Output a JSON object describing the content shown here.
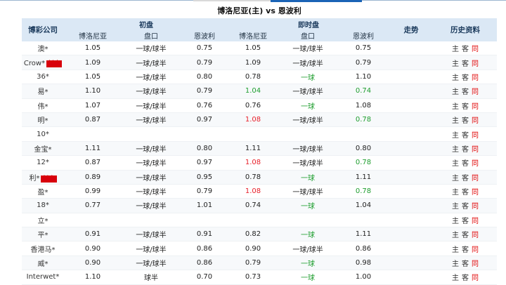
{
  "title": "博洛尼亚(主) vs 恩波利",
  "headers": {
    "company": "博彩公司",
    "initial": "初盘",
    "live": "即时盘",
    "trend": "走势",
    "history": "历史资料",
    "home": "博洛尼亚",
    "line": "盘口",
    "away": "恩波利"
  },
  "history_links": {
    "home": "主",
    "away": "客",
    "same": "同"
  },
  "rows": [
    {
      "company": "澳*",
      "tag": "",
      "i_home": "1.05",
      "i_line": "一球/球半",
      "i_away": "0.75",
      "l_home": "1.05",
      "l_home_c": "",
      "l_line": "一球/球半",
      "l_line_c": "",
      "l_away": "0.75",
      "l_away_c": ""
    },
    {
      "company": "Crow*",
      "tag": "封盘",
      "i_home": "1.09",
      "i_line": "一球/球半",
      "i_away": "0.79",
      "l_home": "1.09",
      "l_home_c": "",
      "l_line": "一球/球半",
      "l_line_c": "",
      "l_away": "0.79",
      "l_away_c": ""
    },
    {
      "company": "36*",
      "tag": "",
      "i_home": "1.05",
      "i_line": "一球/球半",
      "i_away": "0.80",
      "l_home": "0.78",
      "l_home_c": "",
      "l_line": "一球",
      "l_line_c": "green",
      "l_away": "1.10",
      "l_away_c": ""
    },
    {
      "company": "易*",
      "tag": "",
      "i_home": "1.10",
      "i_line": "一球/球半",
      "i_away": "0.79",
      "l_home": "1.04",
      "l_home_c": "green",
      "l_line": "一球/球半",
      "l_line_c": "",
      "l_away": "0.74",
      "l_away_c": "green"
    },
    {
      "company": "伟*",
      "tag": "",
      "i_home": "1.07",
      "i_line": "一球/球半",
      "i_away": "0.76",
      "l_home": "0.76",
      "l_home_c": "",
      "l_line": "一球",
      "l_line_c": "green",
      "l_away": "1.08",
      "l_away_c": ""
    },
    {
      "company": "明*",
      "tag": "",
      "i_home": "0.87",
      "i_line": "一球/球半",
      "i_away": "0.97",
      "l_home": "1.08",
      "l_home_c": "red",
      "l_line": "一球/球半",
      "l_line_c": "",
      "l_away": "0.78",
      "l_away_c": "green"
    },
    {
      "company": "10*",
      "tag": "",
      "i_home": "",
      "i_line": "",
      "i_away": "",
      "l_home": "",
      "l_home_c": "",
      "l_line": "",
      "l_line_c": "",
      "l_away": "",
      "l_away_c": ""
    },
    {
      "company": "金宝*",
      "tag": "",
      "i_home": "1.11",
      "i_line": "一球/球半",
      "i_away": "0.80",
      "l_home": "1.11",
      "l_home_c": "",
      "l_line": "一球/球半",
      "l_line_c": "",
      "l_away": "0.80",
      "l_away_c": ""
    },
    {
      "company": "12*",
      "tag": "",
      "i_home": "0.87",
      "i_line": "一球/球半",
      "i_away": "0.97",
      "l_home": "1.08",
      "l_home_c": "red",
      "l_line": "一球/球半",
      "l_line_c": "",
      "l_away": "0.78",
      "l_away_c": "green"
    },
    {
      "company": "利*",
      "tag": "封盘",
      "i_home": "0.89",
      "i_line": "一球/球半",
      "i_away": "0.95",
      "l_home": "0.78",
      "l_home_c": "",
      "l_line": "一球",
      "l_line_c": "green",
      "l_away": "1.11",
      "l_away_c": ""
    },
    {
      "company": "盈*",
      "tag": "",
      "i_home": "0.99",
      "i_line": "一球/球半",
      "i_away": "0.79",
      "l_home": "1.08",
      "l_home_c": "red",
      "l_line": "一球/球半",
      "l_line_c": "",
      "l_away": "0.78",
      "l_away_c": "green"
    },
    {
      "company": "18*",
      "tag": "",
      "i_home": "0.77",
      "i_line": "一球/球半",
      "i_away": "1.01",
      "l_home": "0.74",
      "l_home_c": "",
      "l_line": "一球",
      "l_line_c": "green",
      "l_away": "1.04",
      "l_away_c": ""
    },
    {
      "company": "立*",
      "tag": "",
      "i_home": "",
      "i_line": "",
      "i_away": "",
      "l_home": "",
      "l_home_c": "",
      "l_line": "",
      "l_line_c": "",
      "l_away": "",
      "l_away_c": ""
    },
    {
      "company": "平*",
      "tag": "",
      "i_home": "0.91",
      "i_line": "一球/球半",
      "i_away": "0.91",
      "l_home": "0.82",
      "l_home_c": "",
      "l_line": "一球",
      "l_line_c": "green",
      "l_away": "1.11",
      "l_away_c": ""
    },
    {
      "company": "香港马*",
      "tag": "",
      "i_home": "0.90",
      "i_line": "一球/球半",
      "i_away": "0.86",
      "l_home": "0.90",
      "l_home_c": "",
      "l_line": "一球/球半",
      "l_line_c": "",
      "l_away": "0.86",
      "l_away_c": ""
    },
    {
      "company": "威*",
      "tag": "",
      "i_home": "0.90",
      "i_line": "一球/球半",
      "i_away": "0.86",
      "l_home": "0.79",
      "l_home_c": "",
      "l_line": "一球",
      "l_line_c": "green",
      "l_away": "0.98",
      "l_away_c": ""
    },
    {
      "company": "Interwet*",
      "tag": "",
      "i_home": "1.10",
      "i_line": "球半",
      "i_away": "0.70",
      "l_home": "0.73",
      "l_home_c": "",
      "l_line": "一球",
      "l_line_c": "green",
      "l_away": "1.00",
      "l_away_c": ""
    }
  ]
}
